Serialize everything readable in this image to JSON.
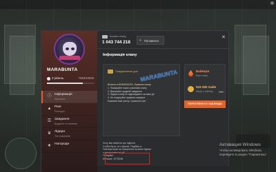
{
  "hud": {
    "left_text": "",
    "right_text": ""
  },
  "clan": {
    "name": "MARABUNTA",
    "level_label": "3 рівень",
    "level_xp": "7684/10000",
    "level_progress": 0.77
  },
  "sidebar": {
    "items": [
      {
        "title": "Інформація",
        "sub": "Загальне",
        "icon": "info-icon",
        "active": true
      },
      {
        "title": "Ранг",
        "sub": "Розподіл",
        "icon": "rank-icon",
        "active": false
      },
      {
        "title": "Завдання",
        "sub": "Щоденні та тижневі",
        "icon": "tasks-icon",
        "active": false
      },
      {
        "title": "Лідери",
        "sub": "Топ учасників",
        "icon": "leaders-icon",
        "active": false
      },
      {
        "title": "Нагороди",
        "sub": "",
        "icon": "rewards-icon",
        "active": false
      }
    ]
  },
  "header": {
    "balance_label": "Баланс клану",
    "balance_value": "1 043 744 218",
    "button_label": "Поповнити",
    "close_glyph": "✕"
  },
  "main": {
    "title": "Інформація клану",
    "notice_label": "Повідомлення дня",
    "rules": [
      "Вітання в MARABUNTA. Правила клану:",
      "1. Поважайте інших учасників клану",
      "2. Виконуйте щоденні завдання",
      "3. Лідери клану не відповідають за ваші дії",
      "4. Не порушуйте правила сервера",
      "Бажаємо вам успіху і приємної гри!"
    ],
    "stamp_text": "MARABUNTA",
    "description": [
      "Хочу вас вивести ще підняти",
      "Чтобы Бути, те є Джоіні, Подбаш а.",
      "Пов'язка всієї на покорення на мене йдемо",
      "з пропусками та дії!",
      "«Старик»",
      "Меньше: 1279338"
    ]
  },
  "rank_panel": {
    "row1_title": "Байкери",
    "row1_sub": "Ранг клану",
    "row1_right": "",
    "row2_title": "515 000 Gaile",
    "row2_sub": "Місце у таблиці",
    "row2_right": "999+",
    "button_label": "ПЕРЕГЛЯНУТИ ТАБЛИЦЮ"
  },
  "windows": {
    "title": "Активация Windows",
    "subtitle": "Чтобы активировать Windows, перейдите в раздел \"Параметры\"."
  },
  "colors": {
    "accent": "#e2622a",
    "sidebar_top": "#5a2e27",
    "highlight_box": "#e02020"
  }
}
